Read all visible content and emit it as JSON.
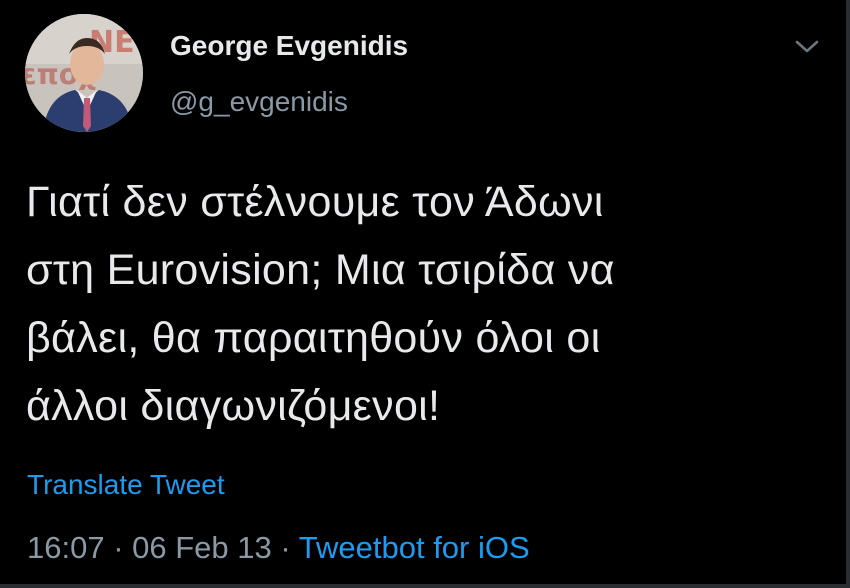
{
  "tweet": {
    "author": {
      "display_name": "George Evgenidis",
      "handle": "@g_evgenidis"
    },
    "text_lines": [
      "Γιατί δεν στέλνουμε τον Άδωνι",
      "στη Eurovision; Μια τσιρίδα να",
      "βάλει, θα παραιτηθούν όλοι οι",
      "άλλοι διαγωνιζόμενοι!"
    ],
    "translate_label": "Translate Tweet",
    "time": "16:07",
    "date": "06 Feb 13",
    "separator": "·",
    "client": "Tweetbot for iOS"
  },
  "icons": {
    "menu": "chevron-down-icon",
    "avatar": "avatar"
  },
  "colors": {
    "background": "#000000",
    "text": "#e7e9ea",
    "secondary": "#8b98a5",
    "link": "#1d9bf0"
  }
}
